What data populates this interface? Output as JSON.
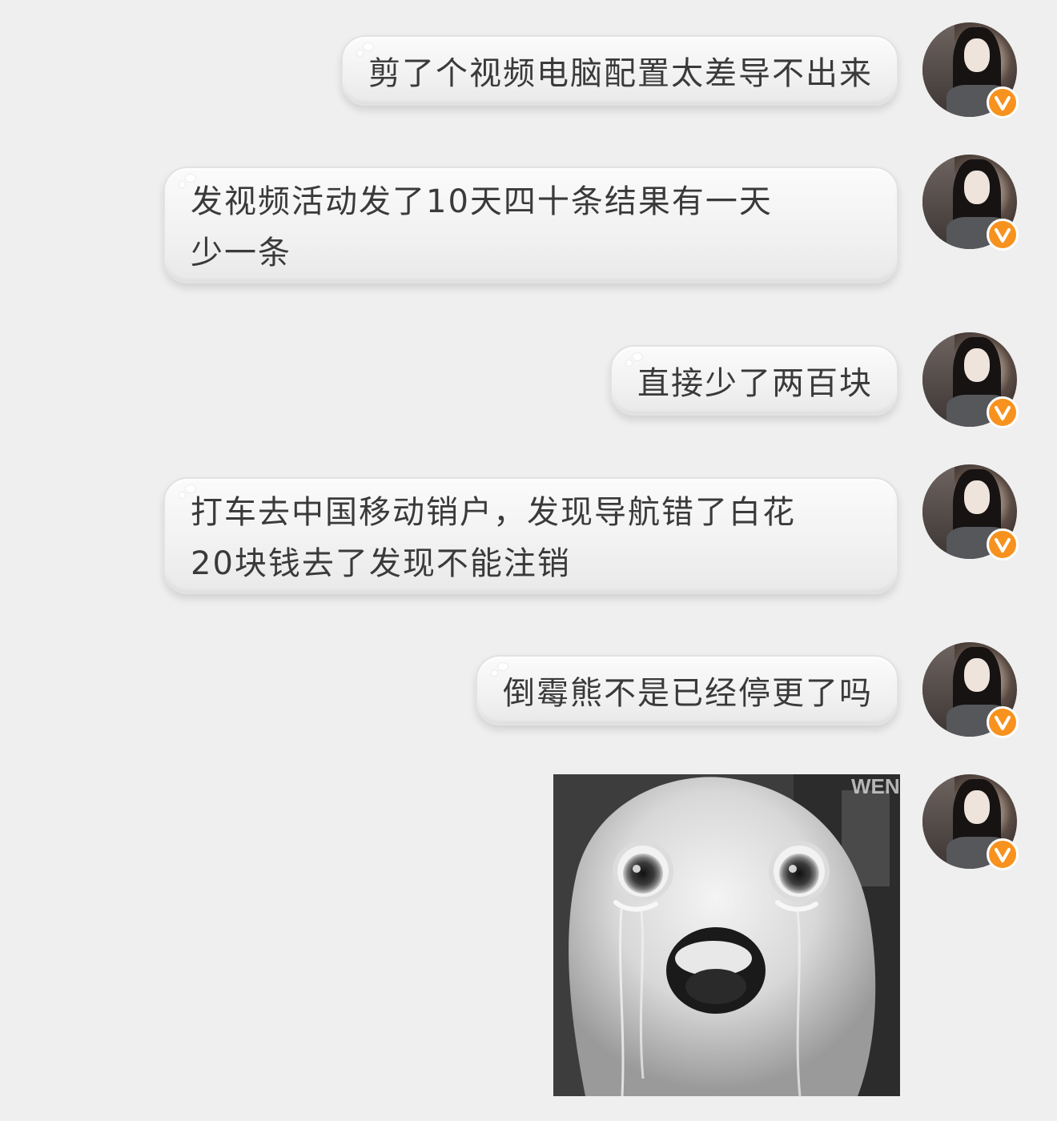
{
  "messages": [
    {
      "text_lines": [
        "剪了个视频电脑配置太差导不出来"
      ]
    },
    {
      "text_lines": [
        "发视频活动发了10天四十条结果有一天",
        "少一条"
      ]
    },
    {
      "text_lines": [
        "直接少了两百块"
      ]
    },
    {
      "text_lines": [
        "打车去中国移动销户，发现导航错了白花",
        "20块钱去了发现不能注销"
      ]
    },
    {
      "text_lines": [
        "倒霉熊不是已经停更了吗"
      ]
    }
  ],
  "sticker": {
    "watermark": "WEN",
    "description_icon": "crying-marshmallow-sticker"
  },
  "avatar": {
    "badge_icon": "verified-v-icon",
    "badge_color": "#f7921e"
  },
  "colors": {
    "background": "#efefef",
    "bubble": "#f6f6f6",
    "text": "#3a3a3a"
  }
}
